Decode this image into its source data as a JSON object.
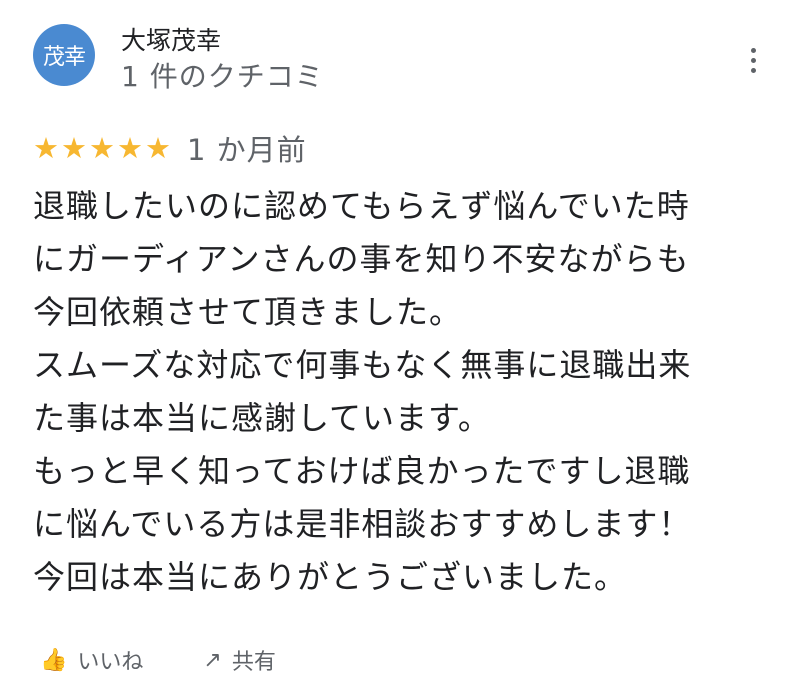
{
  "author": {
    "avatar_text": "茂幸",
    "avatar_color": "#4a8ad1",
    "name": "大塚茂幸",
    "review_count": "1 件のクチコミ"
  },
  "rating": {
    "stars": 5,
    "max_stars": 5,
    "star_color": "#f7b731",
    "date": "1 か月前"
  },
  "review": {
    "lines": [
      "退職したいのに認めてもらえず悩んでいた時",
      "にガーディアンさんの事を知り不安ながらも",
      "今回依頼させて頂きました。",
      "スムーズな対応で何事もなく無事に退職出来",
      "た事は本当に感謝しています。",
      "もっと早く知っておけば良かったですし退職",
      "に悩んでいる方は是非相談おすすめします！",
      "今回は本当にありがとうございました。"
    ]
  },
  "actions": {
    "like_label": "いいね",
    "share_label": "共有"
  }
}
